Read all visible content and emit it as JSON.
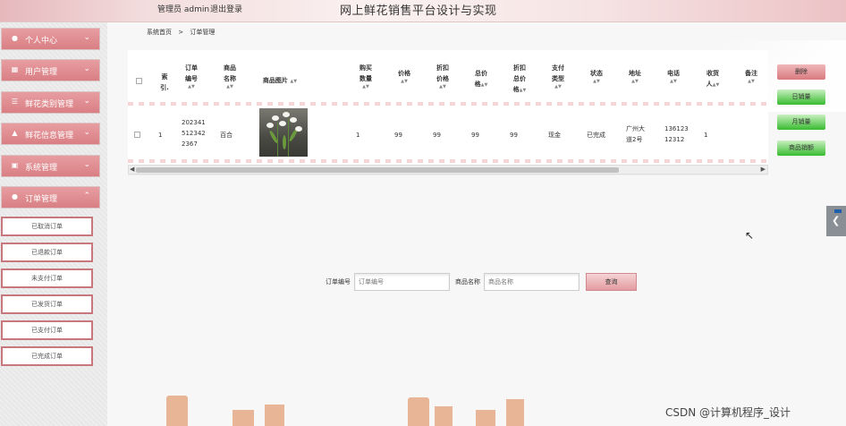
{
  "header": {
    "user_label": "管理员 admin",
    "logout_label": "退出登录",
    "title": "网上鲜花销售平台设计与实现"
  },
  "sidebar": {
    "menus": [
      {
        "label": "个人中心",
        "icon": "user-icon"
      },
      {
        "label": "用户管理",
        "icon": "grid-icon"
      },
      {
        "label": "鲜花类别管理",
        "icon": "list-icon"
      },
      {
        "label": "鲜花信息管理",
        "icon": "car-icon"
      },
      {
        "label": "系统管理",
        "icon": "monitor-icon"
      },
      {
        "label": "订单管理",
        "icon": "user-icon"
      }
    ],
    "sub_items": [
      "已取消订单",
      "已退款订单",
      "未支付订单",
      "已发货订单",
      "已支付订单",
      "已完成订单"
    ]
  },
  "breadcrumb": {
    "home": "系统首页",
    "sep": ">",
    "current": "订单管理"
  },
  "table": {
    "headers": {
      "index": [
        "索",
        "引."
      ],
      "order_no": [
        "订单",
        "编号"
      ],
      "product_name": [
        "商品",
        "名称"
      ],
      "image": "商品图片",
      "qty": [
        "购买",
        "数量"
      ],
      "price": "价格",
      "discount_price": [
        "折扣",
        "价格"
      ],
      "total": [
        "总价",
        "格"
      ],
      "discount_total": [
        "折扣",
        "总价",
        "格"
      ],
      "pay_type": [
        "支付",
        "类型"
      ],
      "status": "状态",
      "address": "地址",
      "phone": "电话",
      "receiver": [
        "收货",
        "人"
      ],
      "remark": "备注"
    },
    "row": {
      "index": "1",
      "order_no": [
        "202341",
        "512342",
        "2367"
      ],
      "product_name": "百合",
      "qty": "1",
      "price": "99",
      "discount_price": "99",
      "total": "99",
      "discount_total": "99",
      "pay_type": "现金",
      "status": "已完成",
      "address": [
        "广州大",
        "道2号"
      ],
      "phone": [
        "136123",
        "12312"
      ],
      "receiver": "1"
    }
  },
  "actions": {
    "delete": "删除",
    "daily_sales": "日销量",
    "monthly_sales": "月销量",
    "product_sales": "商品销额"
  },
  "search": {
    "order_no_label": "订单编号",
    "order_no_placeholder": "订单编号",
    "product_label": "商品名称",
    "product_placeholder": "商品名称",
    "button": "查询"
  },
  "watermark": "CSDN @计算机程序_设计",
  "colors": {
    "menu": "#d97f84",
    "green": "#38bb30",
    "delete": "#d97a7f",
    "skyline": "#e8b696"
  }
}
